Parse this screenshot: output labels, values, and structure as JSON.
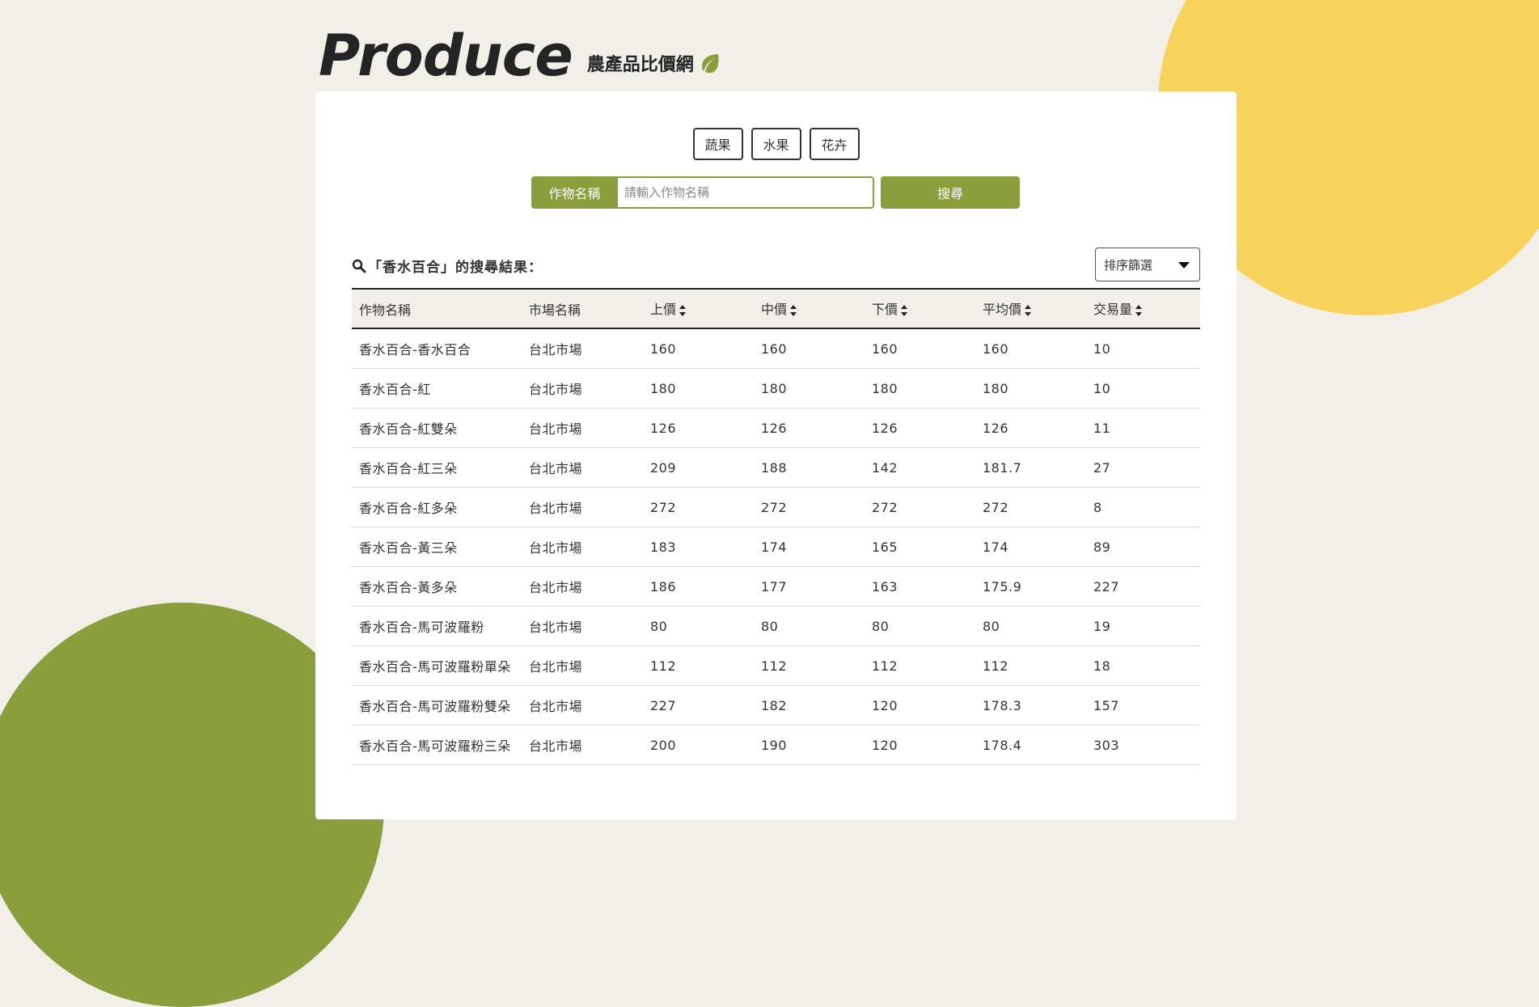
{
  "brand": {
    "logo": "Produce",
    "subtitle": "農產品比價網"
  },
  "categories": [
    "蔬果",
    "水果",
    "花卉"
  ],
  "search": {
    "label": "作物名稱",
    "placeholder": "請輸入作物名稱",
    "value": "",
    "button": "搜尋"
  },
  "results": {
    "title": "「香水百合」的搜尋結果：",
    "sort_label": "排序篩選"
  },
  "table": {
    "columns": [
      "作物名稱",
      "市場名稱",
      "上價",
      "中價",
      "下價",
      "平均價",
      "交易量"
    ],
    "rows": [
      [
        "香水百合-香水百合",
        "台北市場",
        "160",
        "160",
        "160",
        "160",
        "10"
      ],
      [
        "香水百合-紅",
        "台北市場",
        "180",
        "180",
        "180",
        "180",
        "10"
      ],
      [
        "香水百合-紅雙朵",
        "台北市場",
        "126",
        "126",
        "126",
        "126",
        "11"
      ],
      [
        "香水百合-紅三朵",
        "台北市場",
        "209",
        "188",
        "142",
        "181.7",
        "27"
      ],
      [
        "香水百合-紅多朵",
        "台北市場",
        "272",
        "272",
        "272",
        "272",
        "8"
      ],
      [
        "香水百合-黃三朵",
        "台北市場",
        "183",
        "174",
        "165",
        "174",
        "89"
      ],
      [
        "香水百合-黃多朵",
        "台北市場",
        "186",
        "177",
        "163",
        "175.9",
        "227"
      ],
      [
        "香水百合-馬可波羅粉",
        "台北市場",
        "80",
        "80",
        "80",
        "80",
        "19"
      ],
      [
        "香水百合-馬可波羅粉單朵",
        "台北市場",
        "112",
        "112",
        "112",
        "112",
        "18"
      ],
      [
        "香水百合-馬可波羅粉雙朵",
        "台北市場",
        "227",
        "182",
        "120",
        "178.3",
        "157"
      ],
      [
        "香水百合-馬可波羅粉三朵",
        "台北市場",
        "200",
        "190",
        "120",
        "178.4",
        "303"
      ]
    ]
  },
  "colors": {
    "accent_green": "#8a9e3b",
    "accent_yellow": "#f7d35c",
    "background": "#f2efe8"
  }
}
